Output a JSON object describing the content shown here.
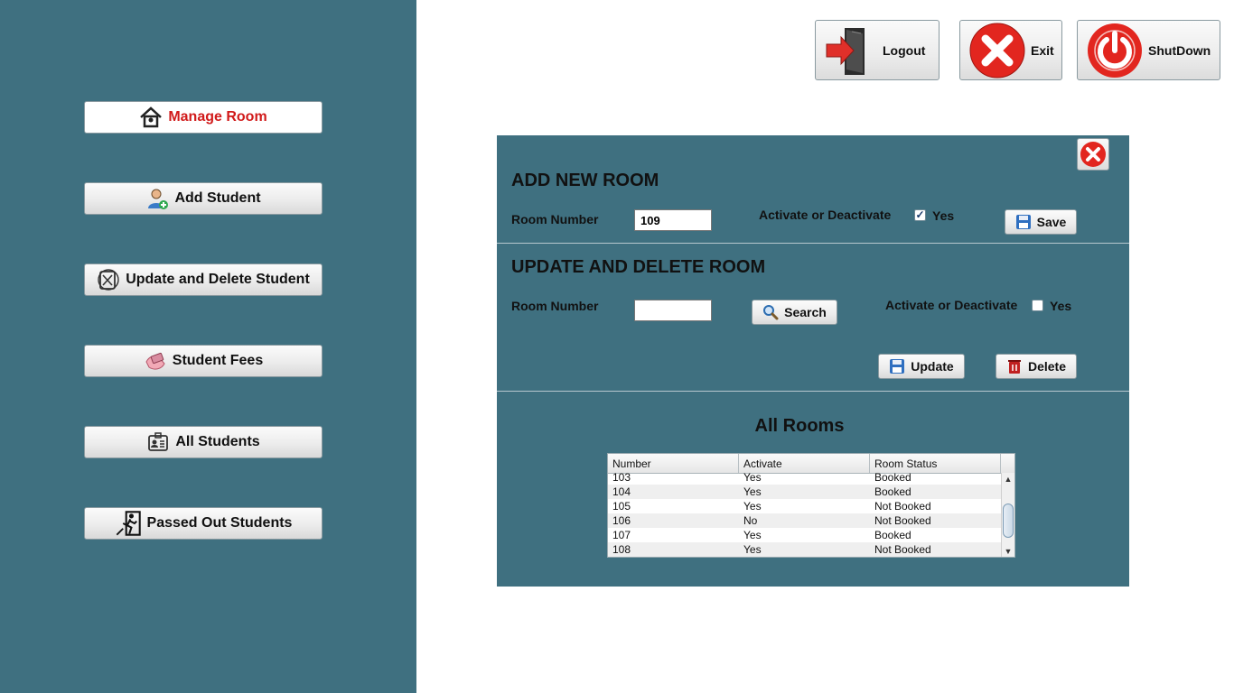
{
  "sidebar": {
    "items": [
      {
        "label": "Manage Room",
        "icon": "house-icon",
        "active": true
      },
      {
        "label": "Add Student",
        "icon": "user-add-icon"
      },
      {
        "label": "Update and Delete Student",
        "icon": "edit-user-icon"
      },
      {
        "label": "Student Fees",
        "icon": "money-hand-icon"
      },
      {
        "label": "All Students",
        "icon": "id-card-icon"
      },
      {
        "label": "Passed Out Students",
        "icon": "exit-runner-icon"
      }
    ]
  },
  "topbar": {
    "logout_label": "Logout",
    "exit_label": "Exit",
    "shutdown_label": "ShutDown"
  },
  "add_room": {
    "title": "ADD NEW ROOM",
    "room_number_label": "Room Number",
    "room_number_value": "109",
    "activate_label": "Activate or Deactivate",
    "checkbox_label": "Yes",
    "checked": true,
    "save_label": "Save"
  },
  "update_room": {
    "title": "UPDATE AND DELETE ROOM",
    "room_number_label": "Room Number",
    "room_number_value": "",
    "search_label": "Search",
    "activate_label": "Activate or Deactivate",
    "checkbox_label": "Yes",
    "checked": false,
    "update_label": "Update",
    "delete_label": "Delete"
  },
  "all_rooms": {
    "title": "All Rooms",
    "columns": [
      "Number",
      "Activate",
      "Room Status"
    ],
    "rows": [
      [
        "103",
        "Yes",
        "Booked"
      ],
      [
        "104",
        "Yes",
        "Booked"
      ],
      [
        "105",
        "Yes",
        "Not Booked"
      ],
      [
        "106",
        "No",
        "Not Booked"
      ],
      [
        "107",
        "Yes",
        "Booked"
      ],
      [
        "108",
        "Yes",
        "Not Booked"
      ]
    ]
  },
  "colors": {
    "sidebar_bg": "#3f7080",
    "active_text": "#d11a1a"
  }
}
